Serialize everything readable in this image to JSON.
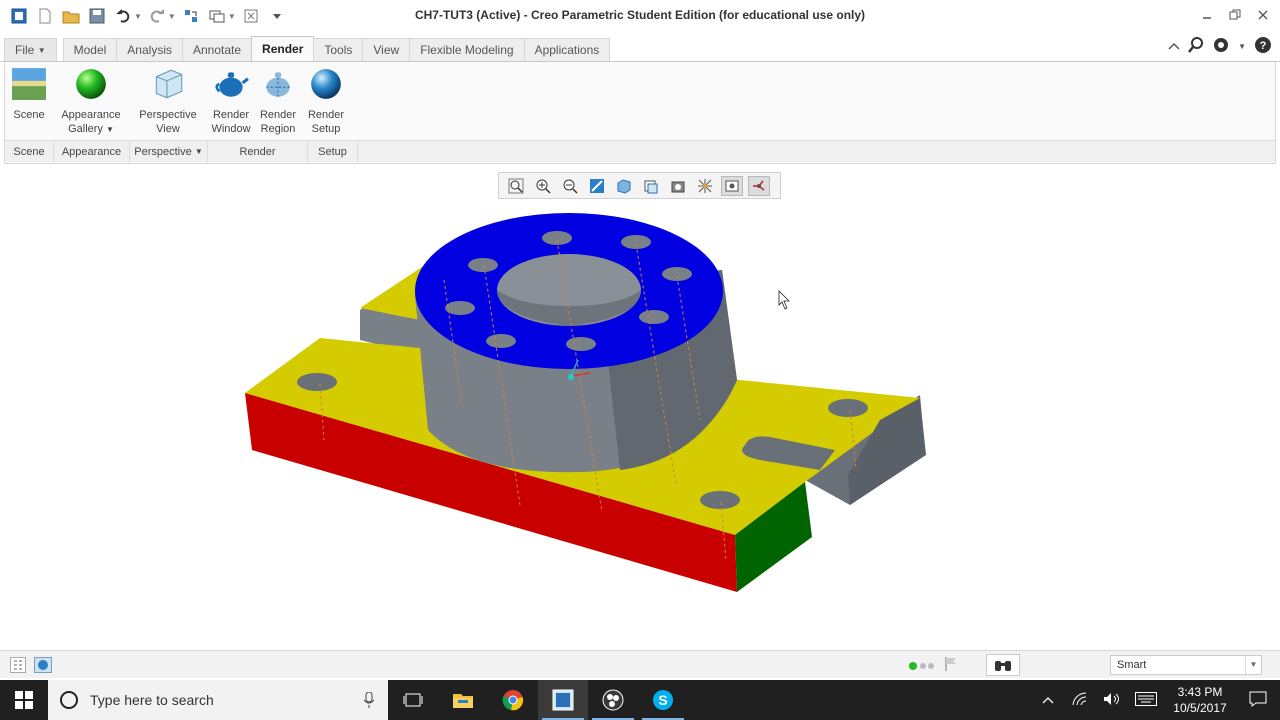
{
  "window": {
    "title": "CH7-TUT3 (Active) - Creo Parametric Student Edition (for educational use only)"
  },
  "tabs": [
    {
      "label": "File",
      "active": false
    },
    {
      "label": "Model",
      "active": false
    },
    {
      "label": "Analysis",
      "active": false
    },
    {
      "label": "Annotate",
      "active": false
    },
    {
      "label": "Render",
      "active": true
    },
    {
      "label": "Tools",
      "active": false
    },
    {
      "label": "View",
      "active": false
    },
    {
      "label": "Flexible Modeling",
      "active": false
    },
    {
      "label": "Applications",
      "active": false
    }
  ],
  "ribbon": {
    "scene_label": "Scene",
    "appearance_line1": "Appearance",
    "appearance_line2": "Gallery",
    "perspective_line1": "Perspective",
    "perspective_line2": "View",
    "render_window_line1": "Render",
    "render_window_line2": "Window",
    "render_region_line1": "Render",
    "render_region_line2": "Region",
    "render_setup_line1": "Render",
    "render_setup_line2": "Setup",
    "groups": {
      "scene": "Scene",
      "appearance": "Appearance",
      "perspective": "Perspective",
      "render": "Render",
      "setup": "Setup"
    }
  },
  "status": {
    "filter_value": "Smart"
  },
  "taskbar": {
    "search_placeholder": "Type here to search",
    "time": "3:43 PM",
    "date": "10/5/2017"
  },
  "colors": {
    "top_face": "#0000e0",
    "base_top": "#d4cc00",
    "base_front": "#c80000",
    "base_side": "#006400",
    "metal": "#7a8088"
  }
}
